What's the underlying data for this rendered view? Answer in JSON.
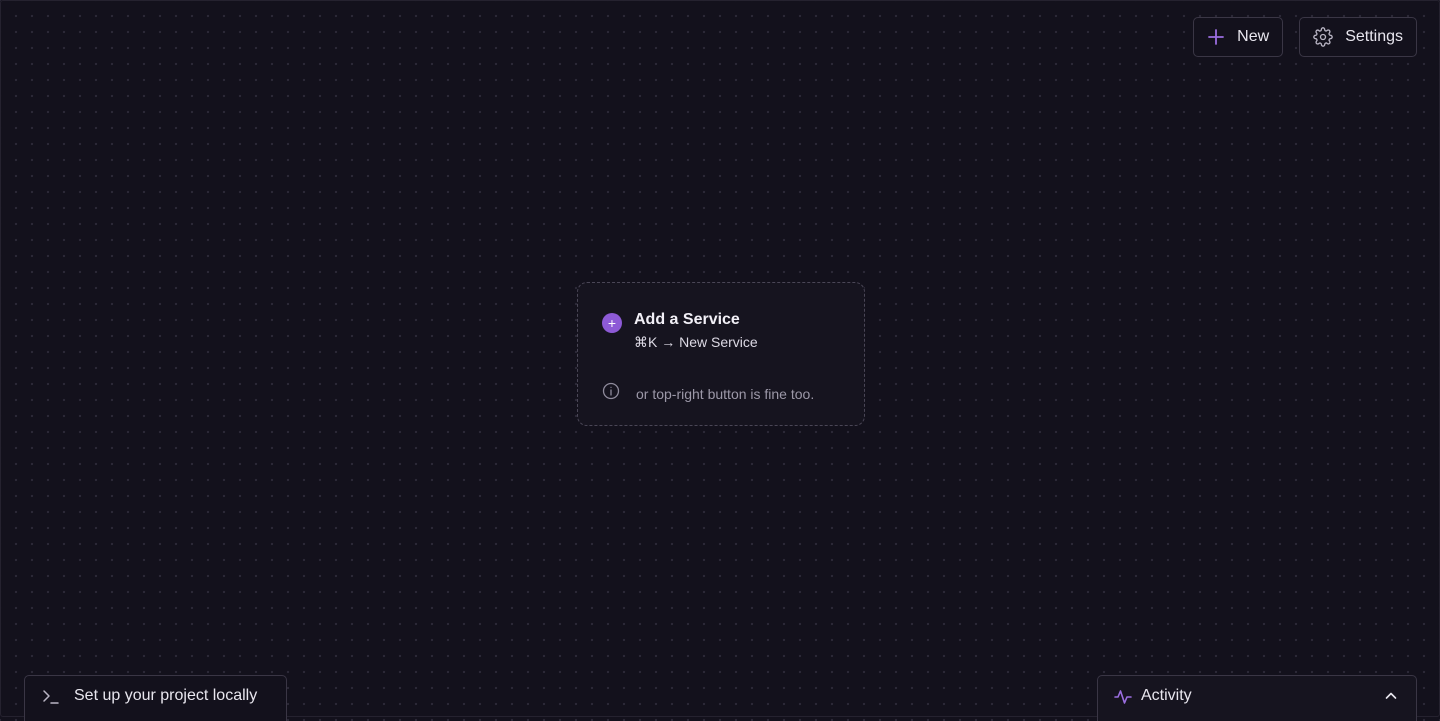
{
  "toolbar": {
    "new_label": "New",
    "settings_label": "Settings"
  },
  "empty_state": {
    "title": "Add a Service",
    "shortcut": "⌘K → New Service",
    "note": "or top-right button is fine too."
  },
  "bottom": {
    "local_setup_label": "Set up your project locally",
    "activity_label": "Activity"
  },
  "icons": {
    "new": "plus-icon",
    "settings": "gear-icon",
    "add_service": "plus-circle-icon",
    "note": "info-icon",
    "local": "terminal-icon",
    "activity": "activity-pulse-icon",
    "activity_toggle": "chevron-up-icon"
  },
  "colors": {
    "background": "#13111c",
    "accent": "#8d5ad6",
    "border": "#3a3645",
    "text": "#e8e6ee",
    "muted_text": "#9c98a8"
  }
}
